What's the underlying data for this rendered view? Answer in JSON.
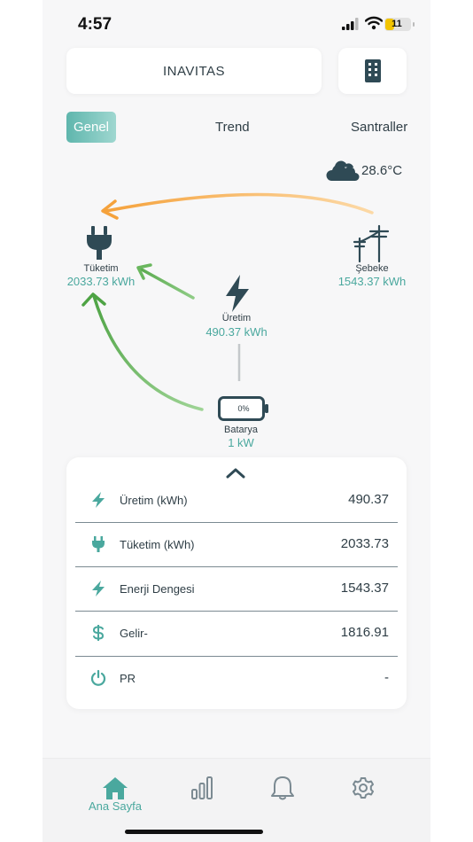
{
  "status_bar": {
    "time": "4:57",
    "battery": "11"
  },
  "header": {
    "title": "INAVITAS"
  },
  "tabs": [
    {
      "label": "Genel",
      "active": true
    },
    {
      "label": "Trend",
      "active": false
    },
    {
      "label": "Santraller",
      "active": false
    }
  ],
  "weather": {
    "temperature": "28.6°C",
    "icon": "cloud-icon"
  },
  "flow": {
    "consumption": {
      "label": "Tüketim",
      "value": "2033.73 kWh",
      "icon": "plug-icon"
    },
    "grid": {
      "label": "Şebeke",
      "value": "1543.37 kWh",
      "icon": "power-pole-icon"
    },
    "production": {
      "label": "Üretim",
      "value": "490.37 kWh",
      "icon": "bolt-icon"
    },
    "battery": {
      "label": "Batarya",
      "value": "1 kW",
      "percent": "0%",
      "icon": "battery-icon"
    }
  },
  "stats": [
    {
      "icon": "bolt-icon",
      "label": "Üretim (kWh)",
      "value": "490.37"
    },
    {
      "icon": "plug-icon",
      "label": "Tüketim (kWh)",
      "value": "2033.73"
    },
    {
      "icon": "bolt-icon",
      "label": "Enerji Dengesi",
      "value": "1543.37"
    },
    {
      "icon": "dollar-icon",
      "label": "Gelir-",
      "value": "1816.91"
    },
    {
      "icon": "power-icon",
      "label": "PR",
      "value": "-"
    }
  ],
  "nav": {
    "home_label": "Ana Sayfa"
  },
  "colors": {
    "accent": "#4aa89e",
    "dark": "#2f3e46",
    "orange_arrow": "#f5a640",
    "green_arrow": "#5aaa4e"
  }
}
